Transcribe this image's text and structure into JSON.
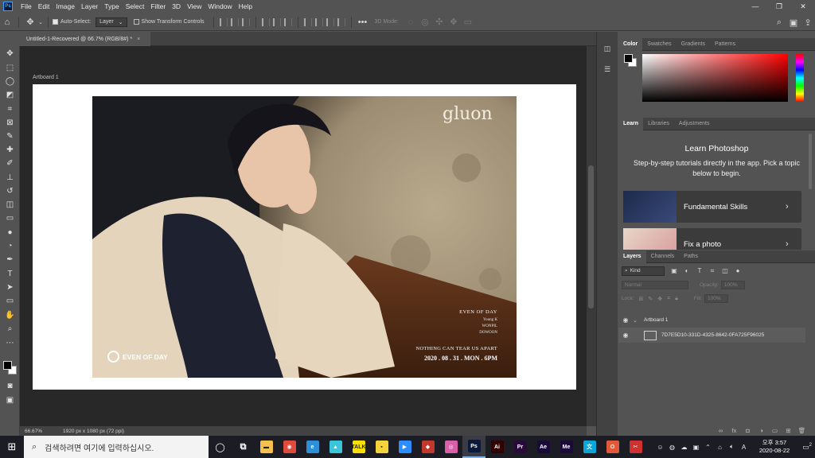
{
  "menubar": {
    "app_logo": "Ps",
    "items": [
      "File",
      "Edit",
      "Image",
      "Layer",
      "Type",
      "Select",
      "Filter",
      "3D",
      "View",
      "Window",
      "Help"
    ],
    "window_controls": [
      "—",
      "❐",
      "✕"
    ]
  },
  "options_bar": {
    "auto_select_label": "Auto-Select:",
    "auto_select_target": "Layer",
    "show_transform_label": "Show Transform Controls",
    "mode_label": "3D Mode:"
  },
  "document_tab": {
    "title": "Untitled-1-Recovered @ 66.7% (RGB/8#) *",
    "close": "×"
  },
  "canvas": {
    "artboard_label": "Artboard 1",
    "image_brand": "gluon",
    "image_tagline": "EVEN OF DAY",
    "image_members": [
      "Young K",
      "WONPIL",
      "DOWOON"
    ],
    "image_slogan": "NOTHING CAN TEAR US APART",
    "image_date": "2020 . 08 . 31 . MON . 6PM",
    "image_logo_text": "EVEN OF DAY"
  },
  "status": {
    "zoom": "66.67%",
    "doc_info": "1920 px x 1080 px (72 ppi)"
  },
  "color_panel": {
    "tabs": [
      "Color",
      "Swatches",
      "Gradients",
      "Patterns"
    ],
    "active_tab": "Color",
    "accent": "#ff0000"
  },
  "learn_panel": {
    "tabs": [
      "Learn",
      "Libraries",
      "Adjustments"
    ],
    "title": "Learn Photoshop",
    "description": "Step-by-step tutorials directly in the app. Pick a topic below to begin.",
    "cards": [
      {
        "label": "Fundamental Skills"
      },
      {
        "label": "Fix a photo"
      }
    ]
  },
  "layers_panel": {
    "tabs": [
      "Layers",
      "Channels",
      "Paths"
    ],
    "kind_label": "Kind",
    "blend_mode": "Normal",
    "opacity_label": "Opacity:",
    "opacity_value": "100%",
    "lock_label": "Lock:",
    "fill_label": "Fill:",
    "fill_value": "100%",
    "layers": [
      {
        "name": "Artboard 1",
        "type": "artboard"
      },
      {
        "name": "7D7E5D10-331D-4325-8642-0FA725F96025",
        "type": "smart-object"
      }
    ]
  },
  "taskbar": {
    "search_placeholder": "검색하려면 여기에 입력하십시오.",
    "apps": [
      {
        "name": "task-view",
        "glyph": "◯"
      },
      {
        "name": "multitask",
        "glyph": "⧉"
      },
      {
        "name": "file-explorer",
        "glyph": "▬",
        "color": "#f2c14e"
      },
      {
        "name": "chrome",
        "glyph": "◉",
        "color": "#e04a3c"
      },
      {
        "name": "edge",
        "glyph": "e",
        "color": "#2d8fd5"
      },
      {
        "name": "bird-app",
        "glyph": "▲",
        "color": "#3cc4d8"
      },
      {
        "name": "kakaotalk",
        "glyph": "TALK",
        "color": "#f9e000"
      },
      {
        "name": "sticky-notes",
        "glyph": "▪",
        "color": "#f4d33a"
      },
      {
        "name": "zoom",
        "glyph": "▶",
        "color": "#2d8cff"
      },
      {
        "name": "game-app",
        "glyph": "◆",
        "color": "#c0392b"
      },
      {
        "name": "camera-app",
        "glyph": "◎",
        "color": "#d85fa8"
      },
      {
        "name": "photoshop",
        "glyph": "Ps",
        "color": "#0a1a3a"
      },
      {
        "name": "illustrator",
        "glyph": "Ai",
        "color": "#330000"
      },
      {
        "name": "premiere",
        "glyph": "Pr",
        "color": "#2a0a3a"
      },
      {
        "name": "after-effects",
        "glyph": "Ae",
        "color": "#1a0a3a"
      },
      {
        "name": "media-encoder",
        "glyph": "Me",
        "color": "#1a0a3a"
      },
      {
        "name": "translate-app",
        "glyph": "文",
        "color": "#0aa6d8"
      },
      {
        "name": "office-app",
        "glyph": "O",
        "color": "#e05a3a"
      },
      {
        "name": "mail-app",
        "glyph": "✂",
        "color": "#d03030"
      }
    ],
    "clock_time": "오후 3:57",
    "clock_date": "2020-08-22",
    "notification_count": "2"
  }
}
